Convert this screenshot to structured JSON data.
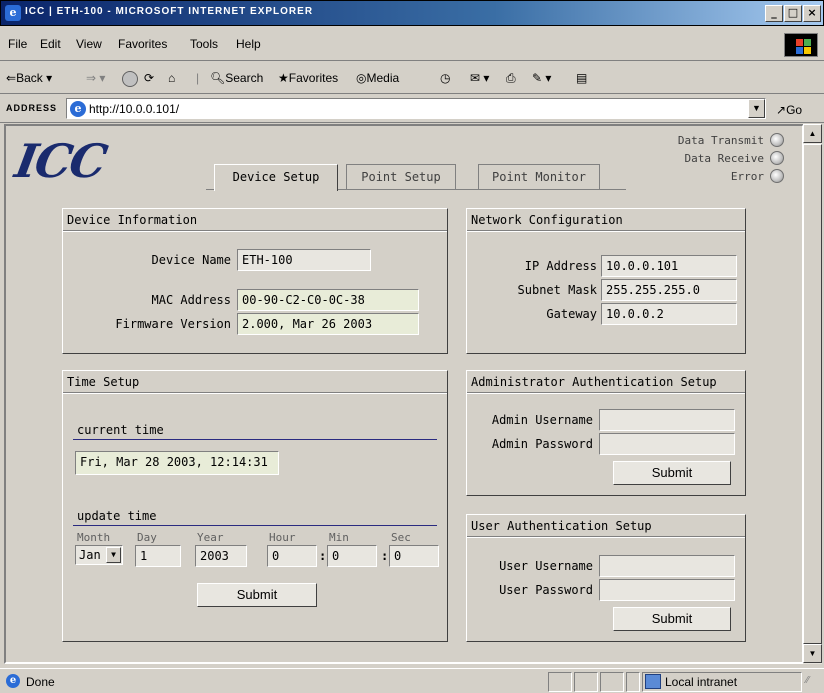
{
  "window": {
    "title": "ICC | ETH-100 - MICROSOFT INTERNET EXPLORER"
  },
  "menu": [
    "File",
    "Edit",
    "View",
    "Favorites",
    "Tools",
    "Help"
  ],
  "toolbar": {
    "back": "Back",
    "search": "Search",
    "favorites": "Favorites",
    "media": "Media"
  },
  "address": {
    "label": "ADDRESS",
    "url": "http://10.0.0.101/",
    "go": "Go"
  },
  "header": {
    "logo": "ICC",
    "tabs": [
      "Device Setup",
      "Point Setup",
      "Point Monitor"
    ],
    "active_tab": 0,
    "indicators": [
      "Data Transmit",
      "Data Receive",
      "Error"
    ]
  },
  "device_info": {
    "title": "Device Information",
    "device_name_label": "Device Name",
    "device_name": "ETH-100",
    "mac_label": "MAC Address",
    "mac": "00-90-C2-C0-0C-38",
    "fw_label": "Firmware Version",
    "fw": "2.000, Mar 26 2003"
  },
  "network": {
    "title": "Network Configuration",
    "ip_label": "IP Address",
    "ip": "10.0.0.101",
    "mask_label": "Subnet Mask",
    "mask": "255.255.255.0",
    "gw_label": "Gateway",
    "gw": "10.0.0.2"
  },
  "time": {
    "title": "Time Setup",
    "current_label": "current time",
    "current": "Fri, Mar 28 2003, 12:14:31",
    "update_label": "update time",
    "col_month": "Month",
    "col_day": "Day",
    "col_year": "Year",
    "col_hour": "Hour",
    "col_min": "Min",
    "col_sec": "Sec",
    "month": "Jan",
    "day": "1",
    "year": "2003",
    "hour": "0",
    "min": "0",
    "sec": "0",
    "sep": ":",
    "submit": "Submit"
  },
  "admin": {
    "title": "Administrator Authentication Setup",
    "user_label": "Admin Username",
    "pass_label": "Admin Password",
    "submit": "Submit"
  },
  "user": {
    "title": "User Authentication Setup",
    "user_label": "User Username",
    "pass_label": "User Password",
    "submit": "Submit"
  },
  "status": {
    "text": "Done",
    "zone": "Local intranet"
  }
}
